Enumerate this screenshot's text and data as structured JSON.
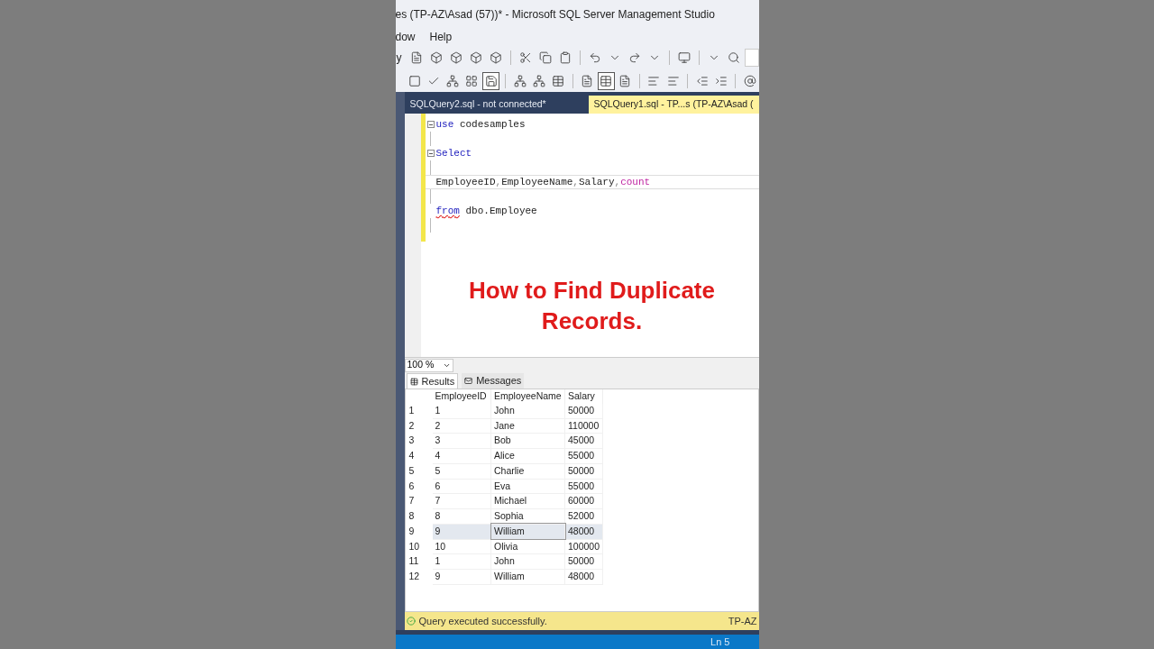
{
  "window": {
    "title": "es (TP-AZ\\Asad (57))* - Microsoft SQL Server Management Studio"
  },
  "menu": [
    "dow",
    "Help"
  ],
  "toolbar": {
    "cut_label": "y"
  },
  "editor_tabs": [
    {
      "label": "SQLQuery2.sql - not connected*",
      "selected": false
    },
    {
      "label": "SQLQuery1.sql - TP...s (TP-AZ\\Asad (",
      "selected": true
    }
  ],
  "code_lines": [
    {
      "fold": true,
      "current": false,
      "tokens": [
        {
          "text": "use",
          "kind": "keyword"
        },
        {
          "text": " codesamples",
          "kind": "plain"
        }
      ]
    },
    {
      "fold": false,
      "current": false
    },
    {
      "fold": true,
      "current": false,
      "tokens": [
        {
          "text": "Select",
          "kind": "keyword"
        }
      ]
    },
    {
      "fold": false,
      "current": false
    },
    {
      "fold": false,
      "current": true,
      "tokens": [
        {
          "text": "EmployeeID",
          "kind": "plain"
        },
        {
          "text": ",",
          "kind": "punct"
        },
        {
          "text": "EmployeeName",
          "kind": "plain"
        },
        {
          "text": ",",
          "kind": "punct"
        },
        {
          "text": "Salary",
          "kind": "plain"
        },
        {
          "text": ",",
          "kind": "punct"
        },
        {
          "text": "count",
          "kind": "function"
        }
      ]
    },
    {
      "fold": false,
      "current": false
    },
    {
      "fold": false,
      "current": false,
      "tokens": [
        {
          "text": "from",
          "kind": "error"
        },
        {
          "text": " dbo.Employee",
          "kind": "plain"
        }
      ]
    },
    {
      "fold": false,
      "current": false
    }
  ],
  "caption": "How to Find Duplicate Records.",
  "zoom": "100 %",
  "result_tabs": [
    {
      "label": "Results",
      "selected": true
    },
    {
      "label": "Messages",
      "selected": false
    }
  ],
  "table": {
    "columns": [
      "EmployeeID",
      "EmployeeName",
      "Salary"
    ],
    "rows": [
      {
        "number": "1",
        "cells": [
          "1",
          "John",
          "50000"
        ],
        "selected": false
      },
      {
        "number": "2",
        "cells": [
          "2",
          "Jane",
          "110000"
        ],
        "selected": false
      },
      {
        "number": "3",
        "cells": [
          "3",
          "Bob",
          "45000"
        ],
        "selected": false
      },
      {
        "number": "4",
        "cells": [
          "4",
          "Alice",
          "55000"
        ],
        "selected": false
      },
      {
        "number": "5",
        "cells": [
          "5",
          "Charlie",
          "50000"
        ],
        "selected": false
      },
      {
        "number": "6",
        "cells": [
          "6",
          "Eva",
          "55000"
        ],
        "selected": false
      },
      {
        "number": "7",
        "cells": [
          "7",
          "Michael",
          "60000"
        ],
        "selected": false
      },
      {
        "number": "8",
        "cells": [
          "8",
          "Sophia",
          "52000"
        ],
        "selected": false
      },
      {
        "number": "9",
        "cells": [
          "9",
          "William",
          "48000"
        ],
        "selected": true
      },
      {
        "number": "10",
        "cells": [
          "10",
          "Olivia",
          "100000"
        ],
        "selected": false
      },
      {
        "number": "11",
        "cells": [
          "1",
          "John",
          "50000"
        ],
        "selected": false
      },
      {
        "number": "12",
        "cells": [
          "9",
          "William",
          "48000"
        ],
        "selected": false
      }
    ]
  },
  "query_status": {
    "message": "Query executed successfully.",
    "server": "TP-AZ"
  },
  "status_bar": {
    "position": "Ln 5"
  }
}
